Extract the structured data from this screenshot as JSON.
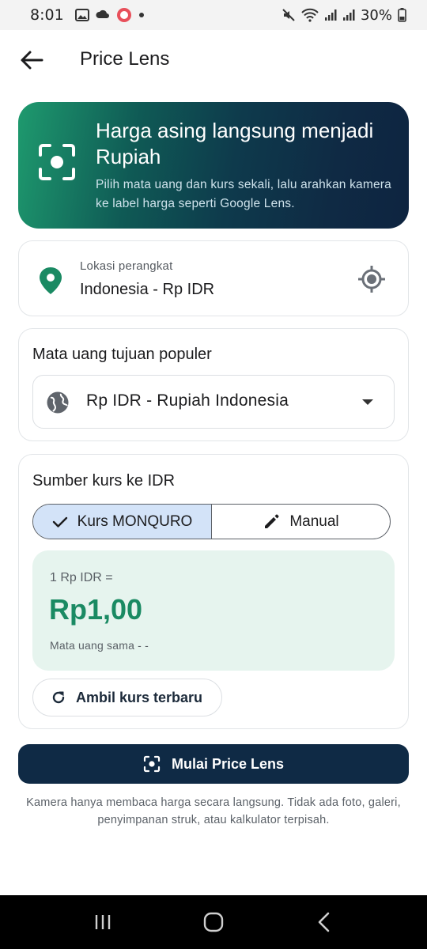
{
  "status_bar": {
    "time": "8:01",
    "battery": "30%"
  },
  "app_bar": {
    "title": "Price Lens"
  },
  "hero": {
    "title": "Harga asing langsung menjadi Rupiah",
    "subtitle": "Pilih mata uang dan kurs sekali, lalu arahkan kamera ke label harga seperti Google Lens."
  },
  "location": {
    "label": "Lokasi perangkat",
    "value": "Indonesia - Rp IDR"
  },
  "currency": {
    "heading": "Mata uang tujuan populer",
    "selected": "Rp IDR - Rupiah Indonesia"
  },
  "rate": {
    "heading": "Sumber kurs ke IDR",
    "segments": [
      {
        "label": "Kurs MONQURO",
        "selected": true
      },
      {
        "label": "Manual",
        "selected": false
      }
    ],
    "equation": "1 Rp IDR =",
    "value": "Rp1,00",
    "note": "Mata uang sama - -",
    "refresh_label": "Ambil kurs terbaru"
  },
  "cta": {
    "label": "Mulai Price Lens"
  },
  "footnote": "Kamera hanya membaca harga secara langsung. Tidak ada foto, galeri, penyimpanan struk, atau kalkulator terpisah.",
  "colors": {
    "accent_green": "#1a8a63",
    "navy": "#0f2a45",
    "segment_selected": "#d3e3f8",
    "rate_box_bg": "#e6f4ee"
  }
}
